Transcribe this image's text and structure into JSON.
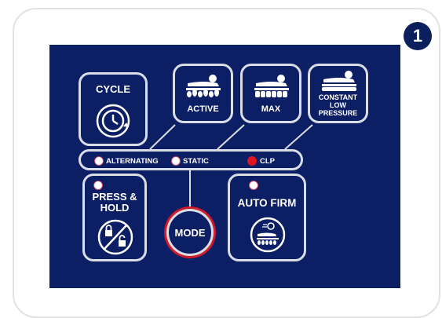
{
  "step": {
    "number": "1"
  },
  "colors": {
    "panel": "#0c1e64",
    "badge": "#0b1f5c",
    "outline": "#d9dde6",
    "clp_active": "#e01522",
    "mode_ring": "#d11a2a"
  },
  "buttons": {
    "cycle": {
      "label": "CYCLE",
      "icon": "clock-cycle-icon"
    },
    "active": {
      "label": "ACTIVE",
      "icon": "mattress-active-icon"
    },
    "max": {
      "label": "MAX",
      "icon": "mattress-max-icon"
    },
    "clp": {
      "label_lines": [
        "CONSTANT",
        "LOW",
        "PRESSURE"
      ],
      "icon": "mattress-constant-low-pressure-icon"
    },
    "press_hold": {
      "label_lines": [
        "PRESS &",
        "HOLD"
      ],
      "icon": "lock-unlock-icon"
    },
    "mode": {
      "label": "MODE"
    },
    "auto_firm": {
      "label": "AUTO FIRM",
      "icon": "auto-firm-mattress-icon"
    }
  },
  "status_indicators": [
    {
      "label": "ALTERNATING",
      "active": false
    },
    {
      "label": "STATIC",
      "active": false
    },
    {
      "label": "CLP",
      "active": true
    }
  ]
}
